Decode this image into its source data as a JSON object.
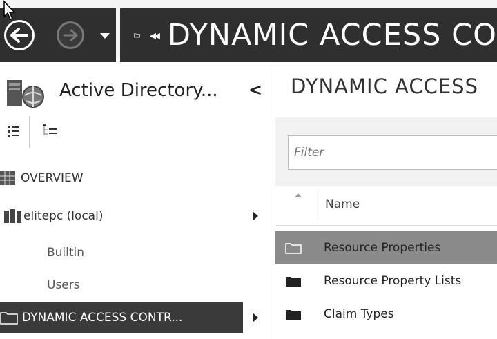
{
  "breadcrumb": {
    "title": "DYNAMIC ACCESS CO"
  },
  "left_pane": {
    "title": "Active Directory...",
    "collapse_glyph": "<",
    "tree": [
      {
        "label": "OVERVIEW",
        "icon": "overview-grid-icon"
      },
      {
        "label": "elitepc (local)",
        "icon": "domain-icon"
      },
      {
        "label": "Builtin",
        "icon": ""
      },
      {
        "label": "Users",
        "icon": ""
      },
      {
        "label": "DYNAMIC ACCESS CONTR...",
        "icon": "folder-icon",
        "selected": true
      }
    ]
  },
  "right_pane": {
    "title": "DYNAMIC ACCESS",
    "filter_placeholder": "Filter",
    "column_header": "Name",
    "rows": [
      {
        "label": "Resource Properties",
        "icon": "folder-icon",
        "selected": true
      },
      {
        "label": "Resource Property Lists",
        "icon": "folder-icon"
      },
      {
        "label": "Claim Types",
        "icon": "folder-icon"
      }
    ]
  },
  "colors": {
    "titlebar_dark": "#2f2f2f",
    "selected_tree_item": "#3a3a3a",
    "selected_row": "#8a8a8a"
  }
}
